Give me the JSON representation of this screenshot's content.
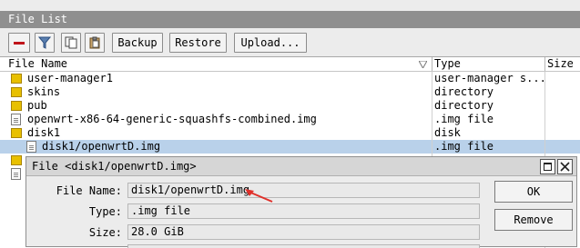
{
  "window": {
    "title": "File List"
  },
  "toolbar": {
    "backup_label": "Backup",
    "restore_label": "Restore",
    "upload_label": "Upload..."
  },
  "table": {
    "headers": {
      "name": "File Name",
      "type": "Type",
      "size": "Size"
    },
    "rows": [
      {
        "name": "user-manager1",
        "type": "user-manager s...",
        "kind": "folder"
      },
      {
        "name": "skins",
        "type": "directory",
        "kind": "folder"
      },
      {
        "name": "pub",
        "type": "directory",
        "kind": "folder"
      },
      {
        "name": "openwrt-x86-64-generic-squashfs-combined.img",
        "type": ".img file",
        "kind": "file"
      },
      {
        "name": "disk1",
        "type": "disk",
        "kind": "folder"
      },
      {
        "name": "disk1/openwrtD.img",
        "type": ".img file",
        "kind": "file",
        "selected": true
      }
    ]
  },
  "dialog": {
    "title": "File <disk1/openwrtD.img>",
    "fields": {
      "file_name_label": "File Name:",
      "file_name_value": "disk1/openwrtD.img",
      "type_label": "Type:",
      "type_value": ".img file",
      "size_label": "Size:",
      "size_value": "28.0 GiB"
    },
    "ok_label": "OK",
    "remove_label": "Remove"
  },
  "colors": {
    "titlebar": "#8f8f8f",
    "selected_row": "#b9d1ea",
    "folder": "#e8c000",
    "annotation_arrow": "#e0302a"
  },
  "icons": [
    "remove-icon",
    "filter-icon",
    "copy-icon",
    "paste-icon",
    "folder-icon",
    "file-icon",
    "sort-icon",
    "maximize-icon",
    "close-icon"
  ]
}
